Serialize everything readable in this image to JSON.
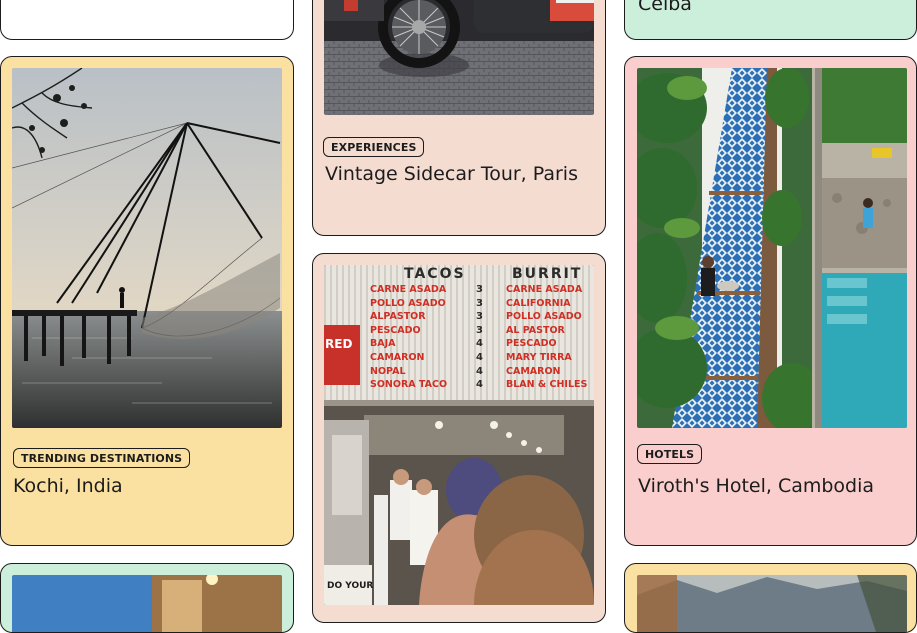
{
  "colors": {
    "yellow": "#fbe1a1",
    "peach": "#f5dcd1",
    "mint": "#ccefdc",
    "pink": "#fbcece",
    "ink": "#1c1c1c"
  },
  "cards": {
    "top_left": {
      "badge": "",
      "title": ""
    },
    "top_right": {
      "title": "Ceiba"
    },
    "sidecar": {
      "badge": "EXPERIENCES",
      "title": "Vintage Sidecar Tour, Paris",
      "image": "sidecar-motorcycle-photo"
    },
    "kochi": {
      "badge": "TRENDING DESTINATIONS",
      "title": "Kochi, India",
      "image": "chinese-fishing-nets-photo"
    },
    "tacos": {
      "badge": "",
      "title": "",
      "image": "taco-shop-menu-photo"
    },
    "viroth": {
      "badge": "HOTELS",
      "title": "Viroth's Hotel, Cambodia",
      "image": "hotel-pool-walkway-photo"
    },
    "bottom_left": {
      "image": "sunset-building-photo"
    },
    "bottom_right": {
      "image": "mountain-sky-photo"
    }
  },
  "menu_board": {
    "col1_header": "TACOS",
    "col2_header": "BURRIT",
    "col1_items": [
      "CARNE ASADA",
      "POLLO ASADO",
      "ALPASTOR",
      "PESCADO",
      "BAJA",
      "CAMARON",
      "NOPAL",
      "SONORA TACO"
    ],
    "col1_prices": [
      "3",
      "3",
      "3",
      "3",
      "4",
      "4",
      "4",
      "4"
    ],
    "col2_items": [
      "CARNE ASADA",
      "CALIFORNIA",
      "POLLO ASADO",
      "AL PASTOR",
      "PESCADO",
      "MARY TIRRA",
      "CAMARON",
      "BLAN & CHILES"
    ],
    "side_sign": "RED",
    "bottom_sign": "DO YOUR"
  }
}
